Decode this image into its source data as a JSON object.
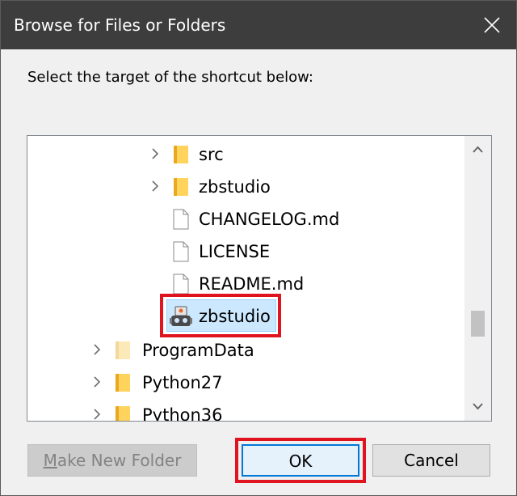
{
  "dialog": {
    "title": "Browse for Files or Folders",
    "instruction": "Select the target of the shortcut below:"
  },
  "tree": {
    "items": [
      {
        "label": "src",
        "icon": "folder-icon",
        "expandable": true,
        "level": 2
      },
      {
        "label": "zbstudio",
        "icon": "folder-icon",
        "expandable": true,
        "level": 2
      },
      {
        "label": "CHANGELOG.md",
        "icon": "file-icon",
        "expandable": false,
        "level": 2
      },
      {
        "label": "LICENSE",
        "icon": "file-icon",
        "expandable": false,
        "level": 2
      },
      {
        "label": "README.md",
        "icon": "file-icon",
        "expandable": false,
        "level": 2
      },
      {
        "label": "zbstudio",
        "icon": "robot-app-icon",
        "expandable": false,
        "level": 2,
        "selected": true
      },
      {
        "label": "ProgramData",
        "icon": "folder-icon",
        "expandable": true,
        "level": 1
      },
      {
        "label": "Python27",
        "icon": "folder-icon",
        "expandable": true,
        "level": 1
      },
      {
        "label": "Python36",
        "icon": "folder-icon",
        "expandable": true,
        "level": 1
      }
    ]
  },
  "buttons": {
    "new_folder_mnemonic": "M",
    "new_folder_rest": "ake New Folder",
    "ok": "OK",
    "cancel": "Cancel"
  },
  "colors": {
    "titlebar": "#3d3d3d",
    "selection": "#cce8ff",
    "annotation_red": "#e0141e",
    "ok_border": "#0078d7"
  }
}
